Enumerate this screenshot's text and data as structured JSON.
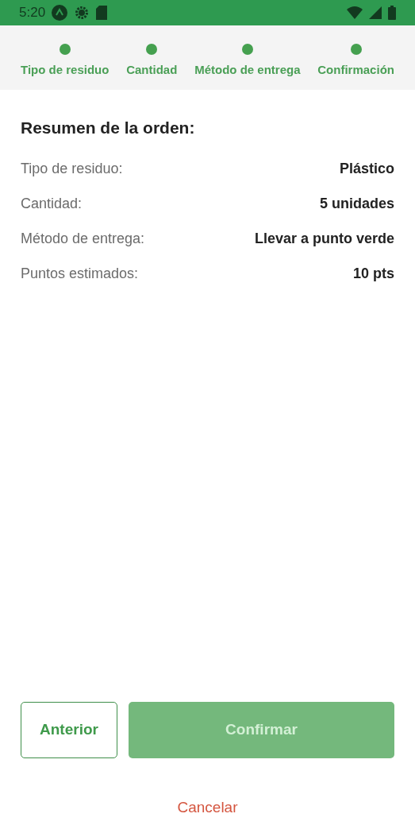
{
  "status_bar": {
    "time": "5:20"
  },
  "steps": [
    {
      "label": "Tipo de residuo",
      "completed": true
    },
    {
      "label": "Cantidad",
      "completed": true
    },
    {
      "label": "Método de entrega",
      "completed": true
    },
    {
      "label": "Confirmación",
      "completed": true
    }
  ],
  "summary": {
    "title": "Resumen de la orden:",
    "rows": [
      {
        "label": "Tipo de residuo:",
        "value": "Plástico"
      },
      {
        "label": "Cantidad:",
        "value": "5 unidades"
      },
      {
        "label": "Método de entrega:",
        "value": "Llevar a punto verde"
      },
      {
        "label": "Puntos estimados:",
        "value": "10 pts"
      }
    ]
  },
  "buttons": {
    "back": {
      "label": "Anterior"
    },
    "confirm": {
      "label": "Confirmar",
      "disabled": true
    },
    "cancel": {
      "label": "Cancelar"
    }
  }
}
